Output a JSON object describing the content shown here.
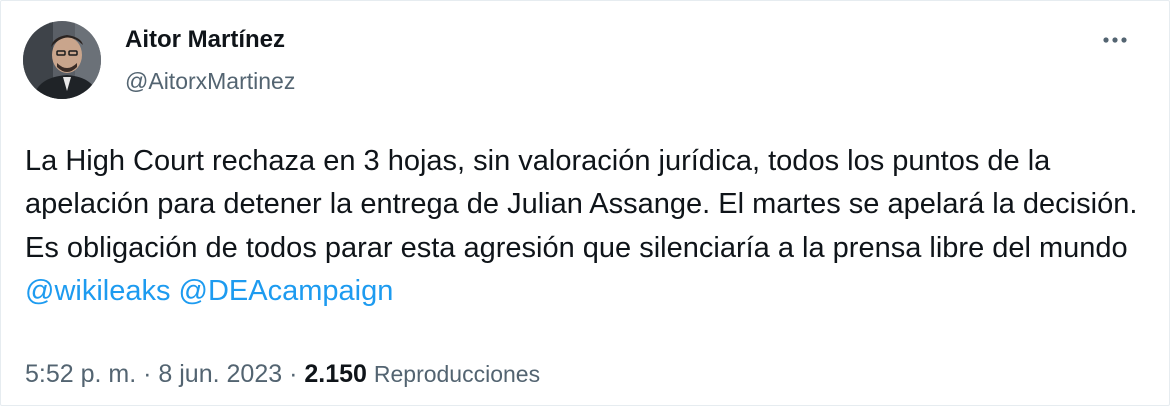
{
  "author": {
    "display_name": "Aitor Martínez",
    "handle": "@AitorxMartinez",
    "avatar_icon": "profile-photo"
  },
  "menu": {
    "icon": "more-horizontal-icon"
  },
  "tweet": {
    "text_before": "La High Court rechaza en 3 hojas, sin valoración jurídica, todos los puntos de la apelación para detener la entrega de Julian Assange. El martes se apelará la decisión. Es obligación de todos parar esta agresión que silenciaría a la prensa libre del mundo ",
    "mentions": [
      "@wikileaks",
      "@DEAcampaign"
    ]
  },
  "meta": {
    "time": "5:52 p. m.",
    "separator": "·",
    "date": "8 jun. 2023",
    "views_count": "2.150",
    "views_label": "Reproducciones"
  },
  "colors": {
    "text": "#0f1419",
    "secondary": "#536471",
    "link": "#1d9bf0",
    "border": "#e6ecf0"
  }
}
